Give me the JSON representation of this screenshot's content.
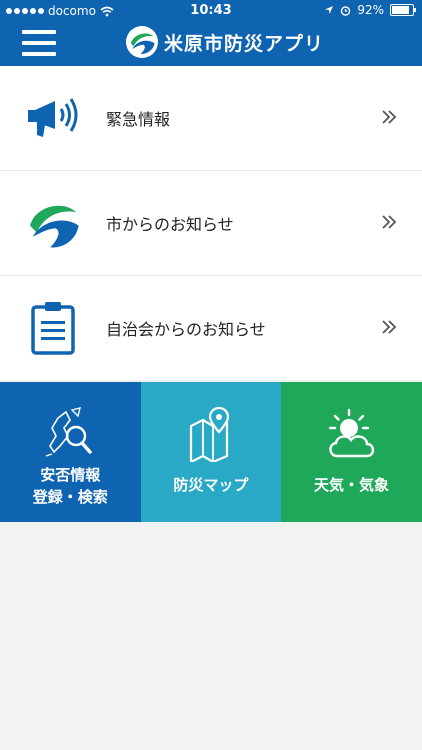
{
  "status_bar": {
    "carrier": "docomo",
    "time": "10:43",
    "battery": "92%",
    "battery_level": 0.92
  },
  "header": {
    "title": "米原市防災アプリ"
  },
  "menu": [
    {
      "label": "緊急情報",
      "icon": "megaphone-icon"
    },
    {
      "label": "市からのお知らせ",
      "icon": "city-logo-icon"
    },
    {
      "label": "自治会からのお知らせ",
      "icon": "clipboard-icon"
    }
  ],
  "tiles": [
    {
      "line1": "安否情報",
      "line2": "登録・検索",
      "icon": "map-search-icon",
      "color": "#0f64b2"
    },
    {
      "label": "防災マップ",
      "icon": "map-pin-icon",
      "color": "#2aa9c6"
    },
    {
      "label": "天気・気象",
      "icon": "sun-cloud-icon",
      "color": "#1fa85a"
    }
  ],
  "colors": {
    "header": "#0f64b2",
    "icon_blue": "#0f64b2",
    "logo_green": "#1fa85a"
  }
}
